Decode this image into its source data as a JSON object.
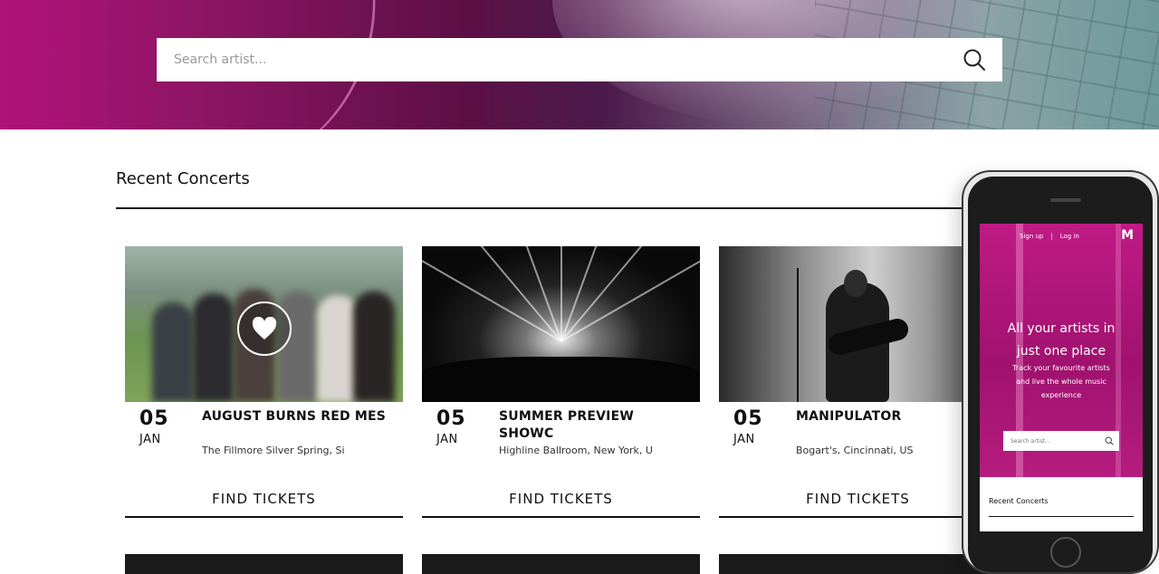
{
  "search": {
    "placeholder": "Search artist..."
  },
  "section": {
    "title": "Recent Concerts"
  },
  "concerts": [
    {
      "day": "05",
      "month": "JAN",
      "name": "AUGUST BURNS RED MES",
      "venue": "The Fillmore Silver Spring, Si",
      "tickets_label": "FIND TICKETS",
      "favorite": true
    },
    {
      "day": "05",
      "month": "JAN",
      "name": "SUMMER PREVIEW SHOWC",
      "venue": "Highline Ballroom, New York, U",
      "tickets_label": "FIND TICKETS",
      "favorite": false
    },
    {
      "day": "05",
      "month": "JAN",
      "name": "MANIPULATOR",
      "venue": "Bogart's, Cincinnati, US",
      "tickets_label": "FIND TICKETS",
      "favorite": false
    }
  ],
  "phone": {
    "nav_signup": "Sign up",
    "nav_separator": "|",
    "nav_login": "Log in",
    "logo": "M",
    "headline": "All your artists in just one place",
    "subtitle": "Track your favourite artists and live the whole music experience",
    "search_placeholder": "Search artist...",
    "section_title": "Recent Concerts"
  },
  "icons": {
    "search": "search-icon",
    "heart": "heart-icon"
  },
  "colors": {
    "accent_magenta": "#b0127a",
    "text": "#111111"
  }
}
